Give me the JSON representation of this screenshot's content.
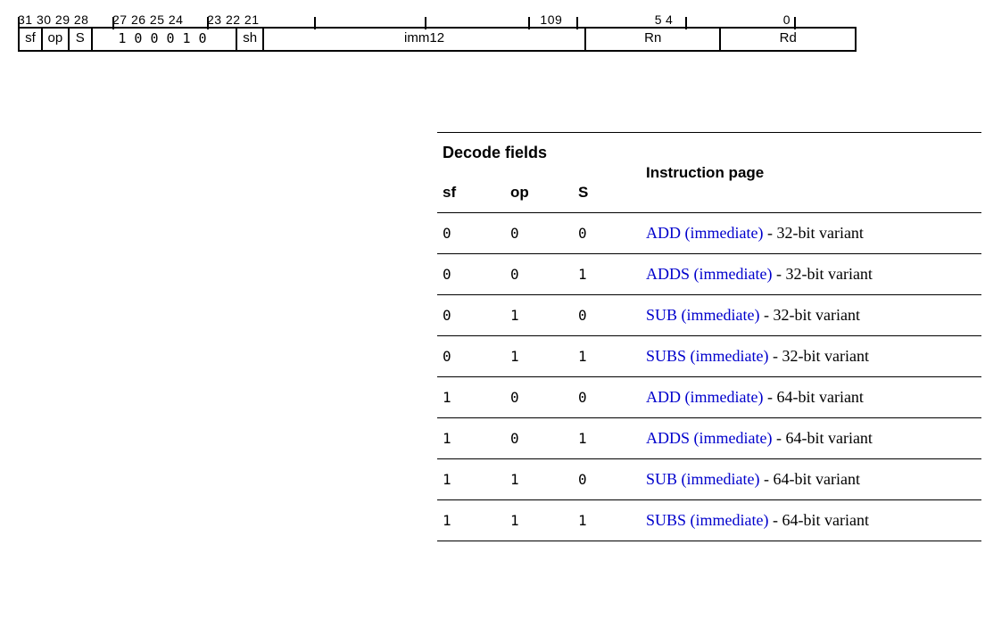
{
  "encoding": {
    "bit_labels": {
      "g1": "31 30 29 28",
      "g2": "27 26 25 24",
      "g3": "23 22 21",
      "b10": "10",
      "b9": "9",
      "b5": "5",
      "b4": "4",
      "b0": "0"
    },
    "fields": {
      "sf": "sf",
      "op": "op",
      "S": "S",
      "fixed": "100010",
      "sh": "sh",
      "imm12": "imm12",
      "Rn": "Rn",
      "Rd": "Rd"
    }
  },
  "table": {
    "group_header": "Decode fields",
    "instruction_header": "Instruction page",
    "cols": {
      "sf": "sf",
      "op": "op",
      "S": "S"
    },
    "rows": [
      {
        "sf": "0",
        "op": "0",
        "S": "0",
        "link": "ADD (immediate)",
        "variant": "32-bit variant"
      },
      {
        "sf": "0",
        "op": "0",
        "S": "1",
        "link": "ADDS (immediate)",
        "variant": "32-bit variant"
      },
      {
        "sf": "0",
        "op": "1",
        "S": "0",
        "link": "SUB (immediate)",
        "variant": "32-bit variant"
      },
      {
        "sf": "0",
        "op": "1",
        "S": "1",
        "link": "SUBS (immediate)",
        "variant": "32-bit variant"
      },
      {
        "sf": "1",
        "op": "0",
        "S": "0",
        "link": "ADD (immediate)",
        "variant": "64-bit variant"
      },
      {
        "sf": "1",
        "op": "0",
        "S": "1",
        "link": "ADDS (immediate)",
        "variant": "64-bit variant"
      },
      {
        "sf": "1",
        "op": "1",
        "S": "0",
        "link": "SUB (immediate)",
        "variant": "64-bit variant"
      },
      {
        "sf": "1",
        "op": "1",
        "S": "1",
        "link": "SUBS (immediate)",
        "variant": "64-bit variant"
      }
    ]
  }
}
